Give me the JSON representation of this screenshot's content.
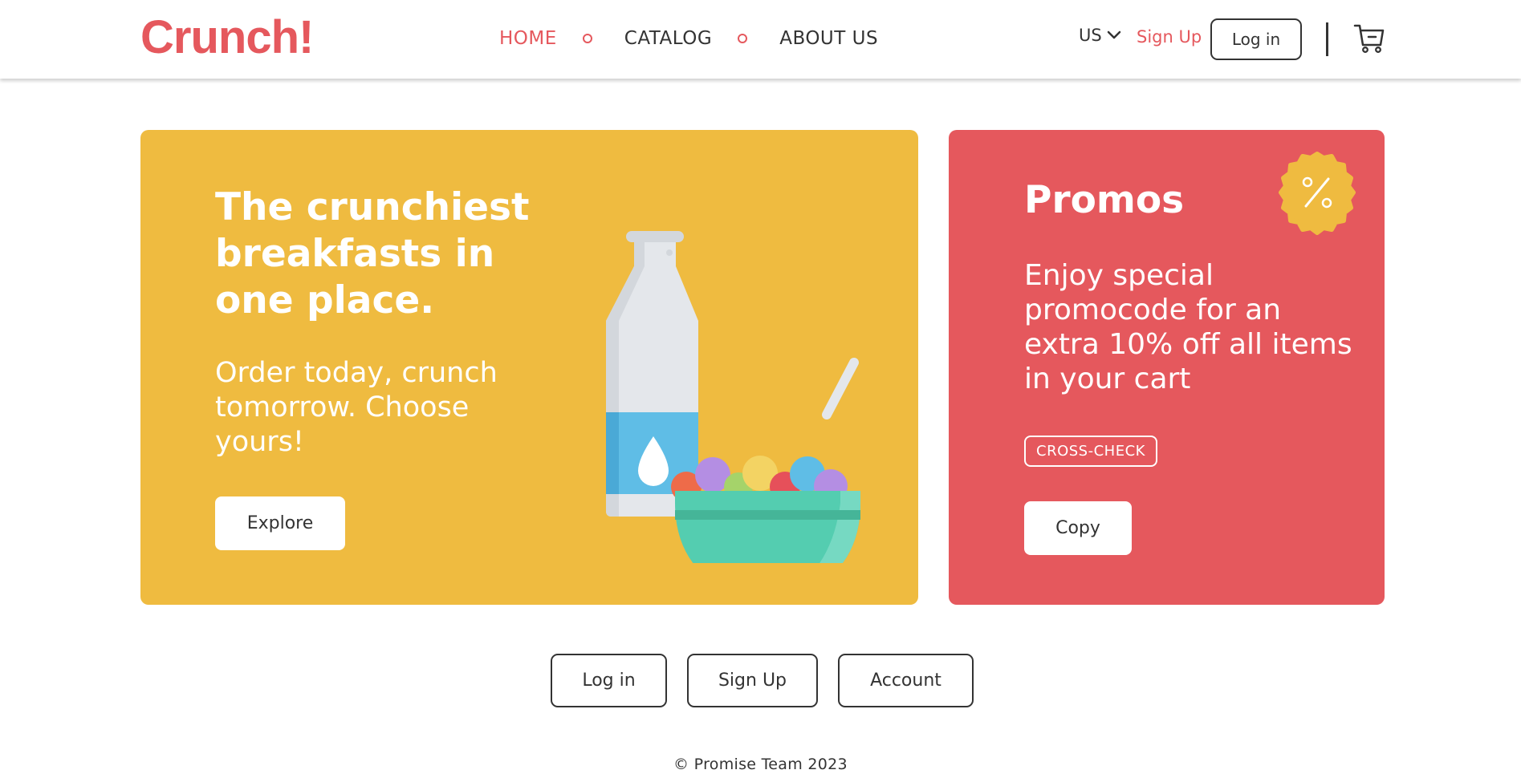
{
  "header": {
    "logo": "Crunch!",
    "nav": [
      {
        "label": "HOME",
        "active": true
      },
      {
        "label": "CATALOG",
        "active": false
      },
      {
        "label": "ABOUT US",
        "active": false
      }
    ],
    "lang": "US",
    "signup_label": "Sign Up",
    "login_label": "Log in",
    "cart_icon": "cart-icon"
  },
  "hero": {
    "title": "The crunchiest breakfasts in one place.",
    "subtitle": "Order today, crunch tomorrow. Choose yours!",
    "button_label": "Explore",
    "illustration": "milk-bottle-and-cereal-bowl",
    "background_color": "#efbb40"
  },
  "promo": {
    "title": "Promos",
    "text": "Enjoy special promocode for an extra 10% off all items in your cart",
    "code": "CROSS-CHECK",
    "button_label": "Copy",
    "badge_icon": "percent-badge-icon",
    "background_color": "#e5585d"
  },
  "bottom_buttons": {
    "login": "Log in",
    "signup": "Sign Up",
    "account": "Account"
  },
  "footer": {
    "text": "© Promise Team 2023"
  },
  "colors": {
    "accent": "#e5585d",
    "yellow": "#efbb40",
    "text": "#333333"
  }
}
